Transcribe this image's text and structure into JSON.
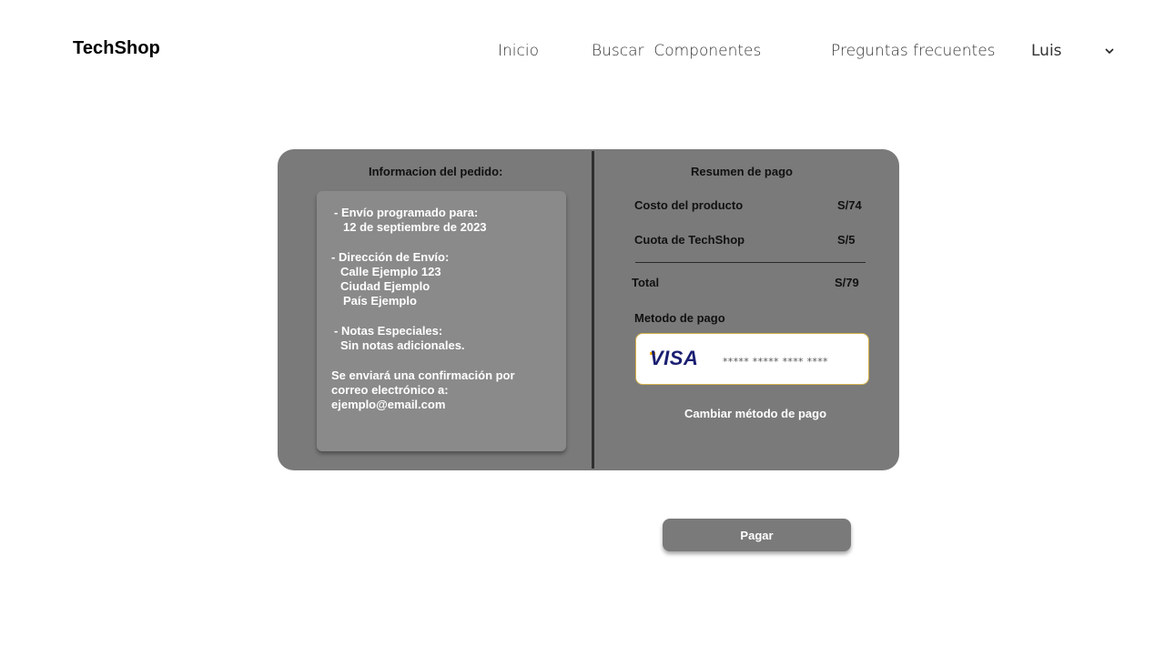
{
  "header": {
    "brand": "TechShop",
    "nav": {
      "home": "Inicio",
      "search": "Buscar  Componentes",
      "faq": "Preguntas frecuentes"
    },
    "user": {
      "name": "Luis",
      "icon": "chevron-down-icon"
    }
  },
  "order_info": {
    "title": "Informacion del pedido:",
    "shipping_label": "- Envío programado para:",
    "shipping_date": "12 de septiembre de 2023",
    "address_label": "- Dirección de Envío:",
    "address_street": "Calle Ejemplo 123",
    "address_city": "Ciudad Ejemplo",
    "address_country": "País Ejemplo",
    "notes_label": "- Notas Especiales:",
    "notes_value": "Sin notas adicionales.",
    "confirmation_line1": "Se enviará una confirmación por",
    "confirmation_line2": "correo electrónico a:",
    "email": "ejemplo@email.com"
  },
  "payment_summary": {
    "title": "Resumen de pago",
    "product_cost_label": "Costo del producto",
    "product_cost_value": "S/74",
    "fee_label": "Cuota de TechShop",
    "fee_value": "S/5",
    "total_label": "Total",
    "total_value": "S/79",
    "method_label": "Metodo de pago",
    "card_brand": "VISA",
    "card_masked": "***** ***** **** ****",
    "change_method": "Cambiar método de pago"
  },
  "actions": {
    "pay": "Pagar"
  },
  "colors": {
    "card_bg": "#7a7a7a",
    "info_box_bg": "#8a8a8a",
    "visa_blue": "#1a1f71",
    "visa_gold": "#f7b600",
    "card_border": "#d4b04a"
  }
}
